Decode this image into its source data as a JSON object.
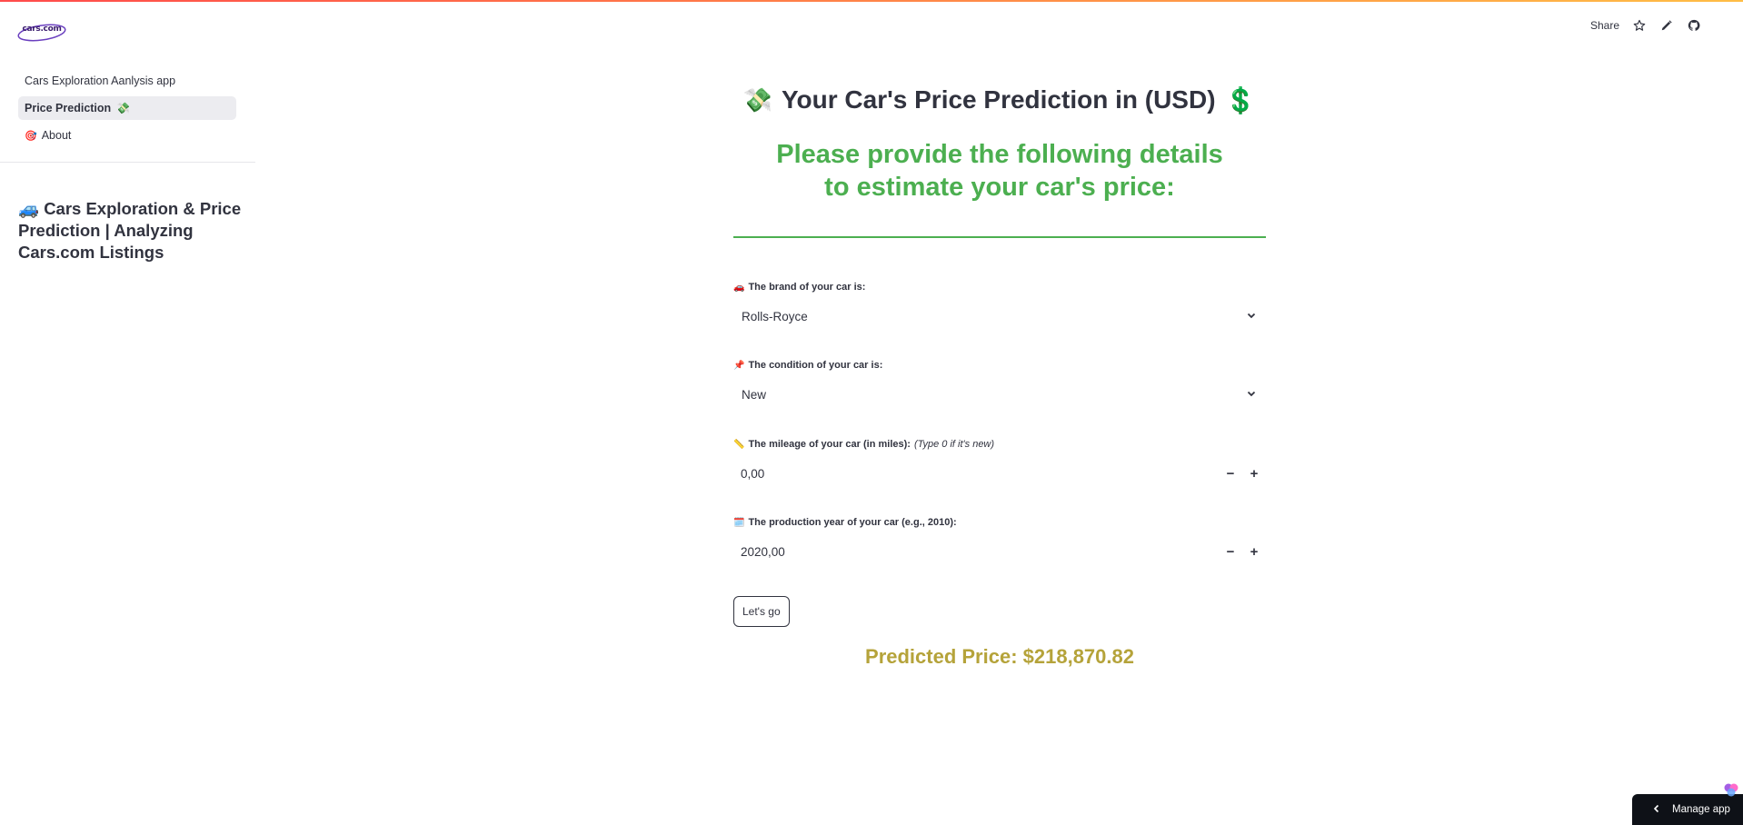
{
  "header": {
    "share_label": "Share",
    "icons": [
      "star-icon",
      "pencil-icon",
      "github-icon"
    ]
  },
  "sidebar": {
    "logo_text": "cars.com",
    "items": [
      {
        "label": "Cars Exploration Aanlysis app",
        "emoji": ""
      },
      {
        "label": "Price Prediction",
        "emoji": "💸"
      },
      {
        "label": "About",
        "emoji": "🎯"
      }
    ],
    "title_emoji": "🚙",
    "title": "Cars Exploration & Price Prediction | Analyzing Cars.com Listings"
  },
  "main": {
    "title_emoji": "💸",
    "title": "Your Car's Price Prediction in (USD)",
    "title_suffix": "💲",
    "subtitle": "Please provide the following details to estimate your car's price:",
    "brand": {
      "emoji": "🚗",
      "label": "The brand of your car is:",
      "value": "Rolls-Royce"
    },
    "condition": {
      "emoji": "📌",
      "label": "The condition of your car is:",
      "value": "New"
    },
    "mileage": {
      "emoji": "📏",
      "label": "The mileage of your car (in miles):",
      "hint": "(Type 0 if it's new)",
      "value": "0,00"
    },
    "year": {
      "emoji": "🗓️",
      "label": "The production year of your car (e.g., 2010):",
      "value": "2020,00"
    },
    "button_label": "Let's go",
    "predicted": "Predicted Price: $218,870.82"
  },
  "footer": {
    "manage_label": "Manage app"
  },
  "colors": {
    "accent_green": "#4caf50",
    "predicted_gold": "#b5a33a",
    "dark": "#0e1117"
  }
}
